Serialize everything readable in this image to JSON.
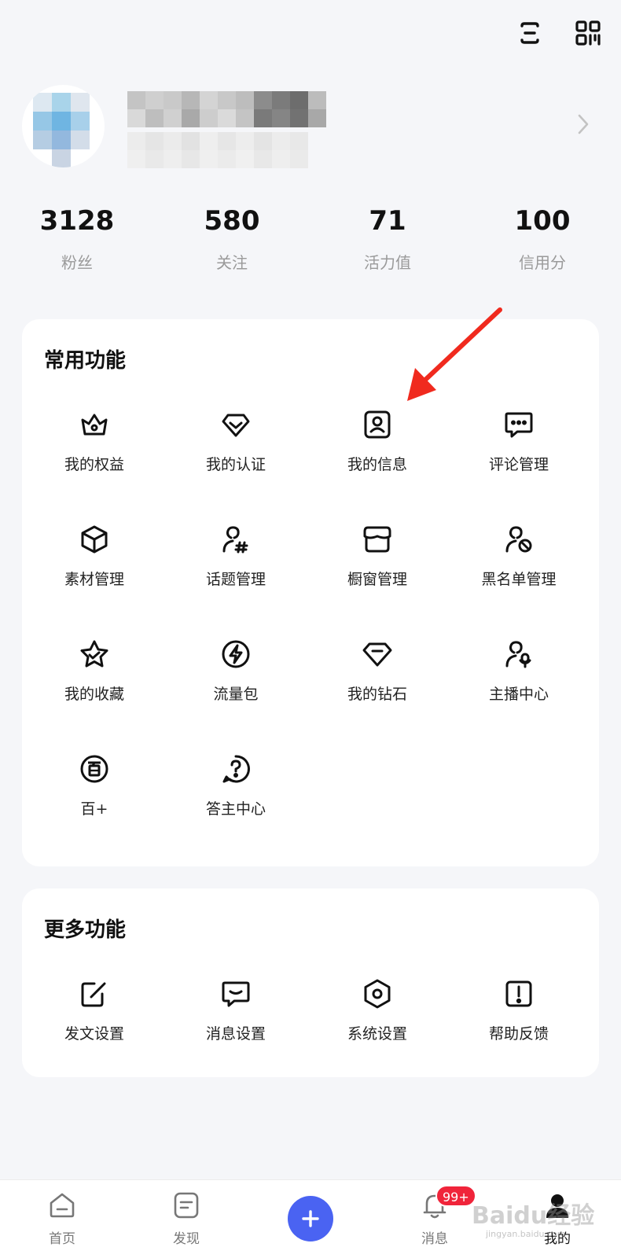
{
  "stats": [
    {
      "value": "3128",
      "label": "粉丝"
    },
    {
      "value": "580",
      "label": "关注"
    },
    {
      "value": "71",
      "label": "活力值"
    },
    {
      "value": "100",
      "label": "信用分"
    }
  ],
  "common": {
    "title": "常用功能",
    "items": [
      {
        "label": "我的权益",
        "icon": "crown-icon"
      },
      {
        "label": "我的认证",
        "icon": "verify-icon"
      },
      {
        "label": "我的信息",
        "icon": "profile-card-icon"
      },
      {
        "label": "评论管理",
        "icon": "comment-icon"
      },
      {
        "label": "素材管理",
        "icon": "box-icon"
      },
      {
        "label": "话题管理",
        "icon": "topic-user-icon"
      },
      {
        "label": "橱窗管理",
        "icon": "shop-icon"
      },
      {
        "label": "黑名单管理",
        "icon": "block-user-icon"
      },
      {
        "label": "我的收藏",
        "icon": "star-icon"
      },
      {
        "label": "流量包",
        "icon": "lightning-icon"
      },
      {
        "label": "我的钻石",
        "icon": "diamond-icon"
      },
      {
        "label": "主播中心",
        "icon": "anchor-icon"
      },
      {
        "label": "百+",
        "icon": "bai-plus-icon"
      },
      {
        "label": "答主中心",
        "icon": "question-icon"
      }
    ]
  },
  "more": {
    "title": "更多功能",
    "items": [
      {
        "label": "发文设置",
        "icon": "edit-icon"
      },
      {
        "label": "消息设置",
        "icon": "message-icon"
      },
      {
        "label": "系统设置",
        "icon": "settings-hex-icon"
      },
      {
        "label": "帮助反馈",
        "icon": "feedback-icon"
      }
    ]
  },
  "tabbar": {
    "home": "首页",
    "discover": "发现",
    "messages": "消息",
    "messages_badge": "99+",
    "mine": "我的",
    "watermark": "Baidu经验",
    "watermark_url": "jingyan.baidu.com"
  },
  "colors": {
    "accent": "#4a63f2",
    "badge": "#f0243a",
    "arrow": "#f02a1e"
  }
}
